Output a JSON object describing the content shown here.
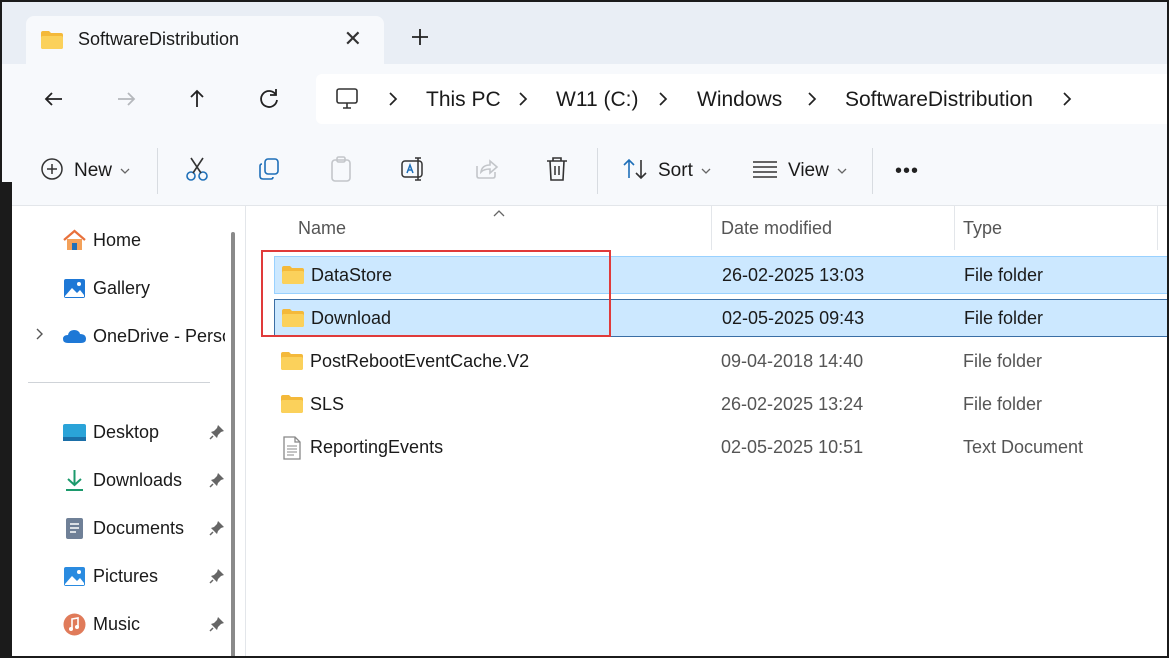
{
  "tab": {
    "title": "SoftwareDistribution",
    "close": "✕",
    "new_tab": "+"
  },
  "breadcrumb": [
    "This PC",
    "W11 (C:)",
    "Windows",
    "SoftwareDistribution"
  ],
  "toolbar": {
    "new_label": "New",
    "sort_label": "Sort",
    "view_label": "View",
    "more_label": "•••"
  },
  "sidebar": {
    "items": [
      {
        "label": "Home",
        "icon": "home-icon"
      },
      {
        "label": "Gallery",
        "icon": "gallery-icon"
      },
      {
        "label": "OneDrive - Personal",
        "icon": "cloud-icon"
      }
    ],
    "pinned": [
      {
        "label": "Desktop",
        "icon": "desktop-icon"
      },
      {
        "label": "Downloads",
        "icon": "download-icon"
      },
      {
        "label": "Documents",
        "icon": "documents-icon"
      },
      {
        "label": "Pictures",
        "icon": "pictures-icon"
      },
      {
        "label": "Music",
        "icon": "music-icon"
      }
    ]
  },
  "columns": {
    "name": "Name",
    "date": "Date modified",
    "type": "Type"
  },
  "files": [
    {
      "name": "DataStore",
      "date": "26-02-2025 13:03",
      "type": "File folder",
      "icon": "folder-icon",
      "selected": true
    },
    {
      "name": "Download",
      "date": "02-05-2025 09:43",
      "type": "File folder",
      "icon": "folder-icon",
      "selected": true
    },
    {
      "name": "PostRebootEventCache.V2",
      "date": "09-04-2018 14:40",
      "type": "File folder",
      "icon": "folder-icon",
      "selected": false
    },
    {
      "name": "SLS",
      "date": "26-02-2025 13:24",
      "type": "File folder",
      "icon": "folder-icon",
      "selected": false
    },
    {
      "name": "ReportingEvents",
      "date": "02-05-2025 10:51",
      "type": "Text Document",
      "icon": "text-file-icon",
      "selected": false
    }
  ],
  "colors": {
    "selection": "#cce8ff",
    "highlight_box": "#e03a3a",
    "folder": "#f7c948"
  }
}
